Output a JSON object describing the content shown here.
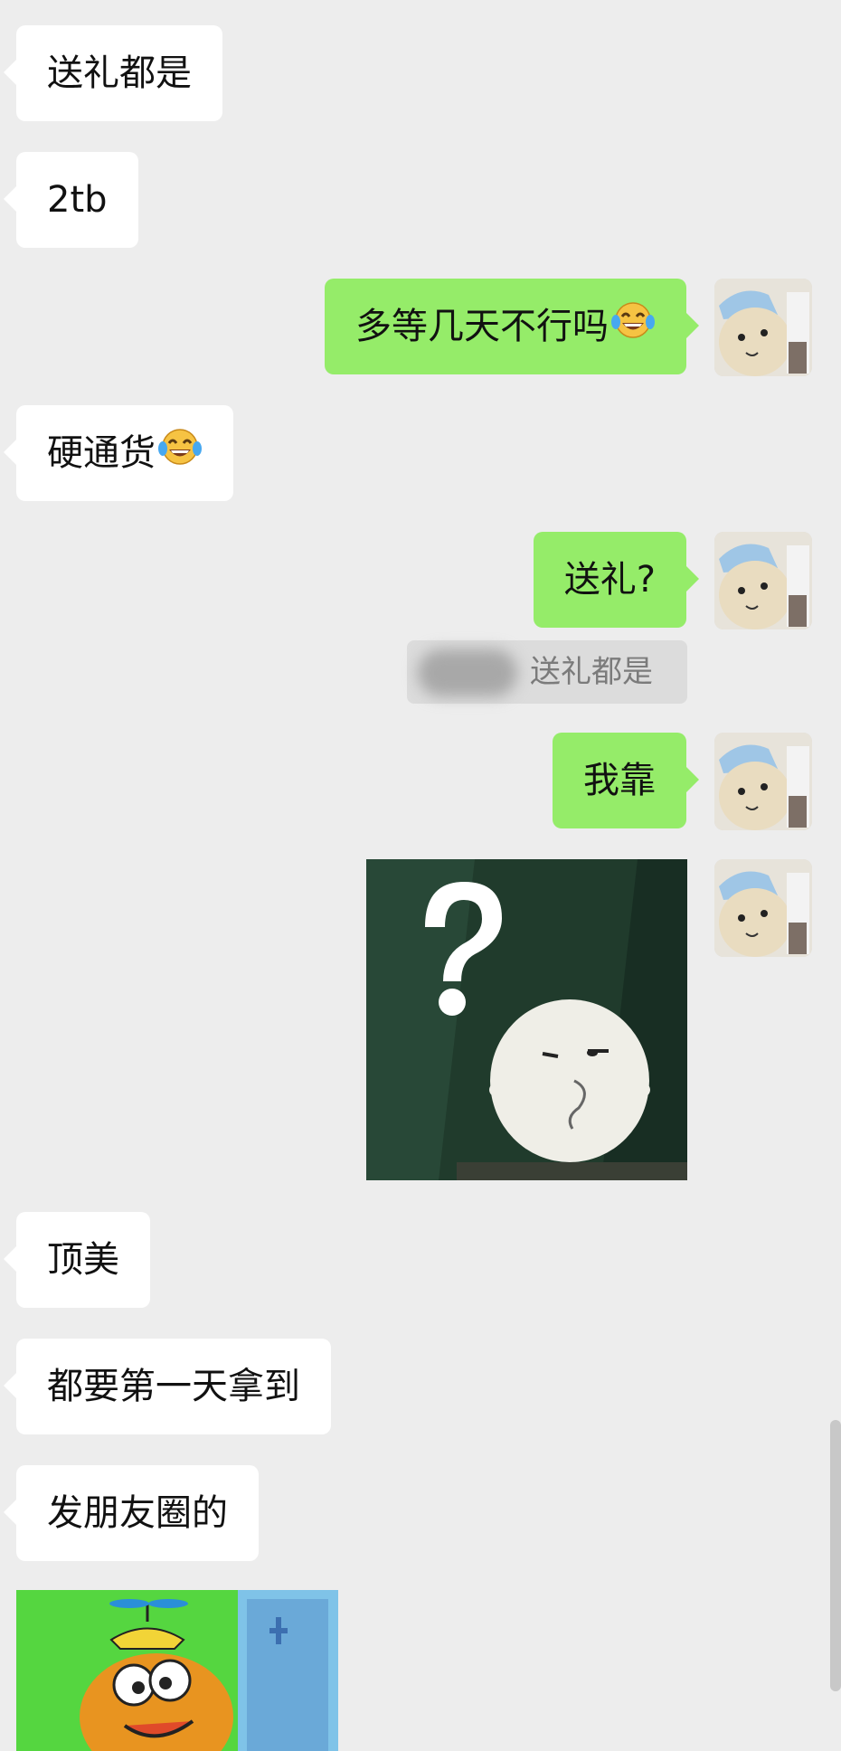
{
  "messages": [
    {
      "side": "left",
      "text": "送礼都是"
    },
    {
      "side": "left",
      "text": "2tb"
    },
    {
      "side": "right",
      "text": "多等几天不行吗",
      "emoji": "tears-of-joy-emoji"
    },
    {
      "side": "left",
      "text": "硬通货",
      "emoji": "tears-of-joy-emoji"
    },
    {
      "side": "right",
      "text": "送礼?"
    },
    {
      "side": "quote",
      "text": "送礼都是"
    },
    {
      "side": "right",
      "text": "我靠"
    },
    {
      "side": "right",
      "type": "sticker",
      "sticker": "question-mark-blob-sticker"
    },
    {
      "side": "left",
      "text": "顶美"
    },
    {
      "side": "left",
      "text": "都要第一天拿到"
    },
    {
      "side": "left",
      "text": "发朋友圈的"
    },
    {
      "side": "left",
      "type": "sticker",
      "sticker": "cartoon-fish-propeller-hat-sticker"
    }
  ],
  "colors": {
    "background": "#ededed",
    "incoming_bubble": "#ffffff",
    "outgoing_bubble": "#95ec69"
  }
}
